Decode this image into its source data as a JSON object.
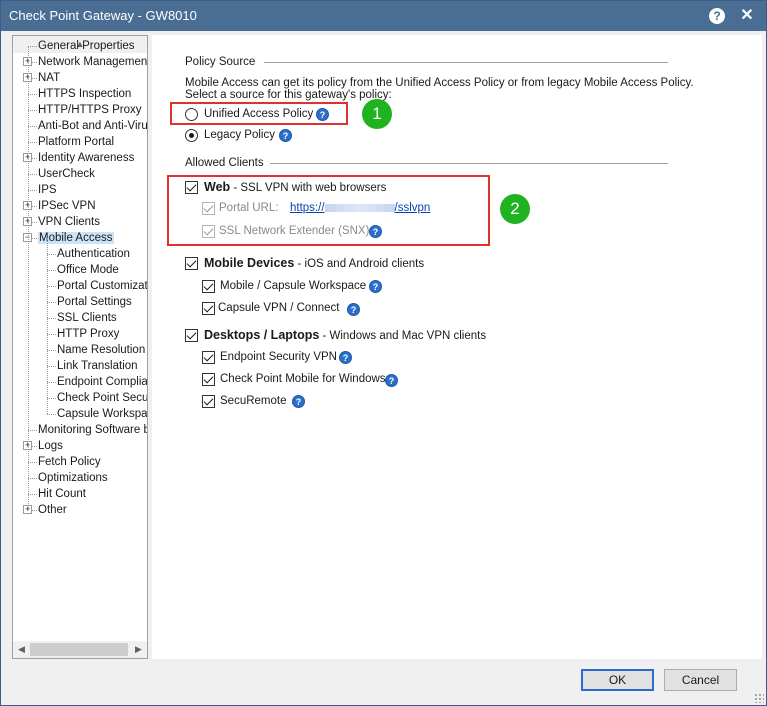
{
  "window": {
    "title": "Check Point Gateway - GW8010",
    "help_glyph": "?",
    "close_glyph": "✕"
  },
  "tree": {
    "items": [
      {
        "label": "General Properties",
        "level": 0,
        "expandable": false
      },
      {
        "label": "Network Management",
        "level": 0,
        "expandable": true
      },
      {
        "label": "NAT",
        "level": 0,
        "expandable": true
      },
      {
        "label": "HTTPS Inspection",
        "level": 0,
        "expandable": false
      },
      {
        "label": "HTTP/HTTPS Proxy",
        "level": 0,
        "expandable": false
      },
      {
        "label": "Anti-Bot and Anti-Virus",
        "level": 0,
        "expandable": false
      },
      {
        "label": "Platform Portal",
        "level": 0,
        "expandable": false
      },
      {
        "label": "Identity Awareness",
        "level": 0,
        "expandable": true
      },
      {
        "label": "UserCheck",
        "level": 0,
        "expandable": false
      },
      {
        "label": "IPS",
        "level": 0,
        "expandable": false
      },
      {
        "label": "IPSec VPN",
        "level": 0,
        "expandable": true
      },
      {
        "label": "VPN Clients",
        "level": 0,
        "expandable": true
      },
      {
        "label": "Mobile Access",
        "level": 0,
        "expandable": "open",
        "selected": true
      },
      {
        "label": "Authentication",
        "level": 1
      },
      {
        "label": "Office Mode",
        "level": 1
      },
      {
        "label": "Portal Customization",
        "level": 1
      },
      {
        "label": "Portal Settings",
        "level": 1
      },
      {
        "label": "SSL Clients",
        "level": 1
      },
      {
        "label": "HTTP Proxy",
        "level": 1
      },
      {
        "label": "Name Resolution",
        "level": 1
      },
      {
        "label": "Link Translation",
        "level": 1
      },
      {
        "label": "Endpoint Compliance",
        "level": 1
      },
      {
        "label": "Check Point Secure Workspace",
        "level": 1
      },
      {
        "label": "Capsule Workspace",
        "level": 1
      },
      {
        "label": "Monitoring Software blades",
        "level": 0,
        "expandable": false
      },
      {
        "label": "Logs",
        "level": 0,
        "expandable": true
      },
      {
        "label": "Fetch Policy",
        "level": 0,
        "expandable": false
      },
      {
        "label": "Optimizations",
        "level": 0,
        "expandable": false
      },
      {
        "label": "Hit Count",
        "level": 0,
        "expandable": false
      },
      {
        "label": "Other",
        "level": 0,
        "expandable": true
      }
    ]
  },
  "policy_source": {
    "title": "Policy Source",
    "description_line1": "Mobile Access can get its policy from the Unified Access Policy or from legacy Mobile Access Policy.",
    "description_line2": "Select a source for this gateway's policy:",
    "unified_label": "Unified Access Policy",
    "legacy_label": "Legacy Policy",
    "selected": "legacy"
  },
  "allowed_clients": {
    "title": "Allowed Clients",
    "web": {
      "label": "Web",
      "desc": " - SSL VPN with web browsers",
      "checked": true,
      "portal_url_label": "Portal URL:",
      "portal_url_prefix": "https://",
      "portal_url_suffix": "/sslvpn",
      "snx_label": "SSL Network Extender (SNX)"
    },
    "mobile": {
      "label": "Mobile Devices",
      "desc": " - iOS and Android clients",
      "checked": true,
      "items": [
        "Mobile / Capsule Workspace",
        "Capsule VPN / Connect"
      ]
    },
    "desktops": {
      "label": "Desktops / Laptops",
      "desc": " - Windows and Mac VPN clients",
      "checked": true,
      "items": [
        "Endpoint Security VPN",
        "Check Point Mobile for Windows",
        "SecuRemote"
      ]
    }
  },
  "annotations": {
    "badge1": "1",
    "badge2": "2",
    "highlight_color": "#e03030",
    "badge_color": "#1fb41f"
  },
  "buttons": {
    "ok": "OK",
    "cancel": "Cancel"
  }
}
